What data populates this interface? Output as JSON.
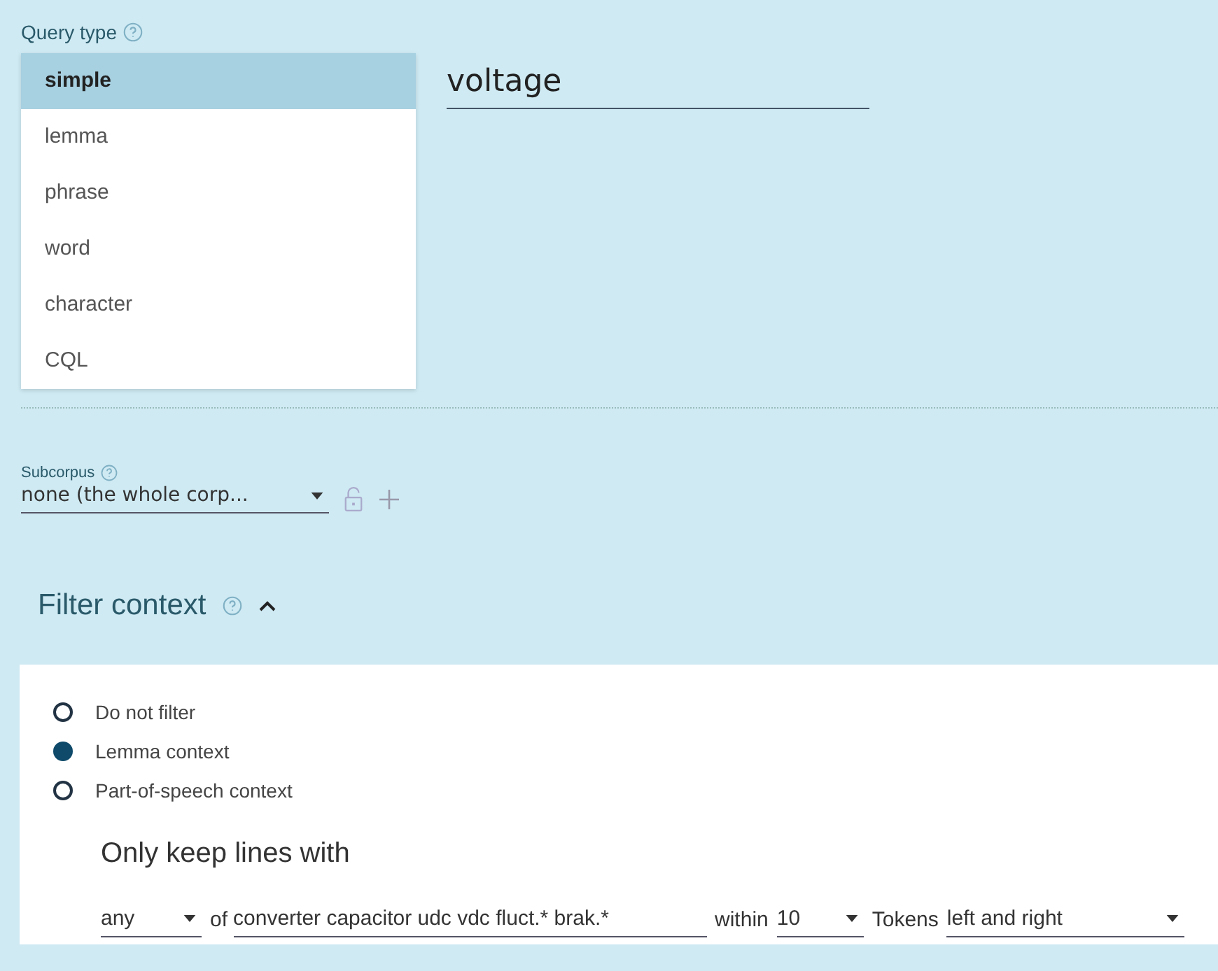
{
  "query_type": {
    "label": "Query type",
    "options": [
      {
        "label": "simple",
        "selected": true
      },
      {
        "label": "lemma",
        "selected": false
      },
      {
        "label": "phrase",
        "selected": false
      },
      {
        "label": "word",
        "selected": false
      },
      {
        "label": "character",
        "selected": false
      },
      {
        "label": "CQL",
        "selected": false
      }
    ]
  },
  "query": {
    "value": "voltage"
  },
  "subcorpus": {
    "label": "Subcorpus",
    "value": "none (the whole corp..."
  },
  "filter_context": {
    "title": "Filter context",
    "expanded": true,
    "options": [
      {
        "label": "Do not filter",
        "selected": false
      },
      {
        "label": "Lemma context",
        "selected": true
      },
      {
        "label": "Part-of-speech context",
        "selected": false
      }
    ],
    "heading": "Only keep lines with",
    "match": {
      "value": "any"
    },
    "of_label": "of",
    "lemmas": {
      "value": "converter capacitor udc vdc fluct.* brak.*"
    },
    "within_label": "within",
    "window": {
      "value": "10"
    },
    "tokens_label": "Tokens",
    "direction": {
      "value": "left and right"
    }
  }
}
